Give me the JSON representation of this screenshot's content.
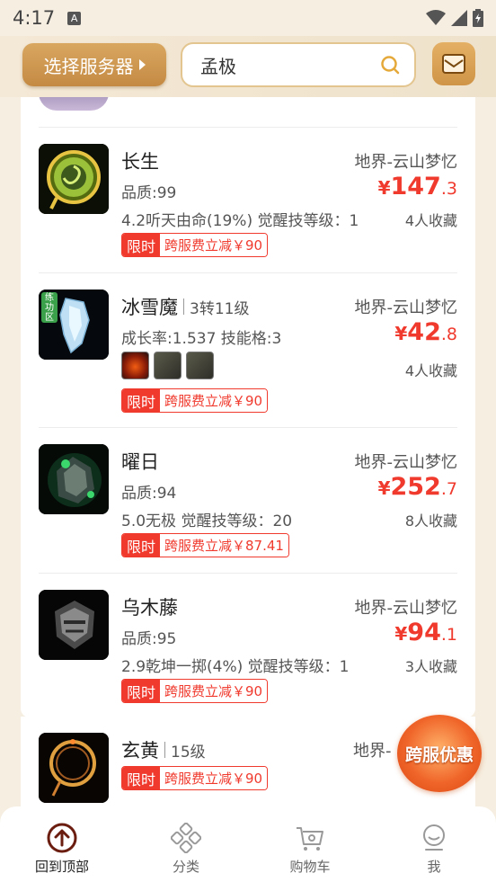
{
  "status_bar": {
    "time": "4:17",
    "badge": "A"
  },
  "header": {
    "server_button_label": "选择服务器",
    "search_value": "孟极"
  },
  "items": [
    {
      "name": "长生",
      "level": "",
      "server": "地界-云山梦忆",
      "price_yen": "¥",
      "price_int": "147",
      "price_dec": ".3",
      "attr1": "品质:99",
      "attr2": "4.2听天由命(19%) 觉醒技等级：1",
      "favorites": "4人收藏",
      "badge_tag": "限时",
      "badge_text": "跨服费立减￥90"
    },
    {
      "name": "冰雪魔",
      "level": "3转11级",
      "server": "地界-云山梦忆",
      "price_yen": "¥",
      "price_int": "42",
      "price_dec": ".8",
      "attr1": "成长率:1.537 技能格:3",
      "favorites": "4人收藏",
      "badge_tag": "限时",
      "badge_text": "跨服费立减￥90",
      "corner_tag": "练功区"
    },
    {
      "name": "曜日",
      "level": "",
      "server": "地界-云山梦忆",
      "price_yen": "¥",
      "price_int": "252",
      "price_dec": ".7",
      "attr1": "品质:94",
      "attr2": "5.0无极 觉醒技等级：20",
      "favorites": "8人收藏",
      "badge_tag": "限时",
      "badge_text": "跨服费立减￥87.41"
    },
    {
      "name": "乌木藤",
      "level": "",
      "server": "地界-云山梦忆",
      "price_yen": "¥",
      "price_int": "94",
      "price_dec": ".1",
      "attr1": "品质:95",
      "attr2": "2.9乾坤一掷(4%) 觉醒技等级：1",
      "favorites": "3人收藏",
      "badge_tag": "限时",
      "badge_text": "跨服费立减￥90"
    },
    {
      "name": "玄黄",
      "level": "15级",
      "server": "地界-",
      "badge_tag": "限时",
      "badge_text": "跨服费立减￥90"
    }
  ],
  "promo_label": "跨服优惠",
  "bottom_nav": [
    {
      "label": "回到顶部",
      "icon": "arrow-up-circle-icon"
    },
    {
      "label": "分类",
      "icon": "category-icon"
    },
    {
      "label": "购物车",
      "icon": "cart-icon"
    },
    {
      "label": "我",
      "icon": "user-icon"
    }
  ],
  "colors": {
    "accent": "#f03a2e",
    "gold": "#d9a760"
  }
}
